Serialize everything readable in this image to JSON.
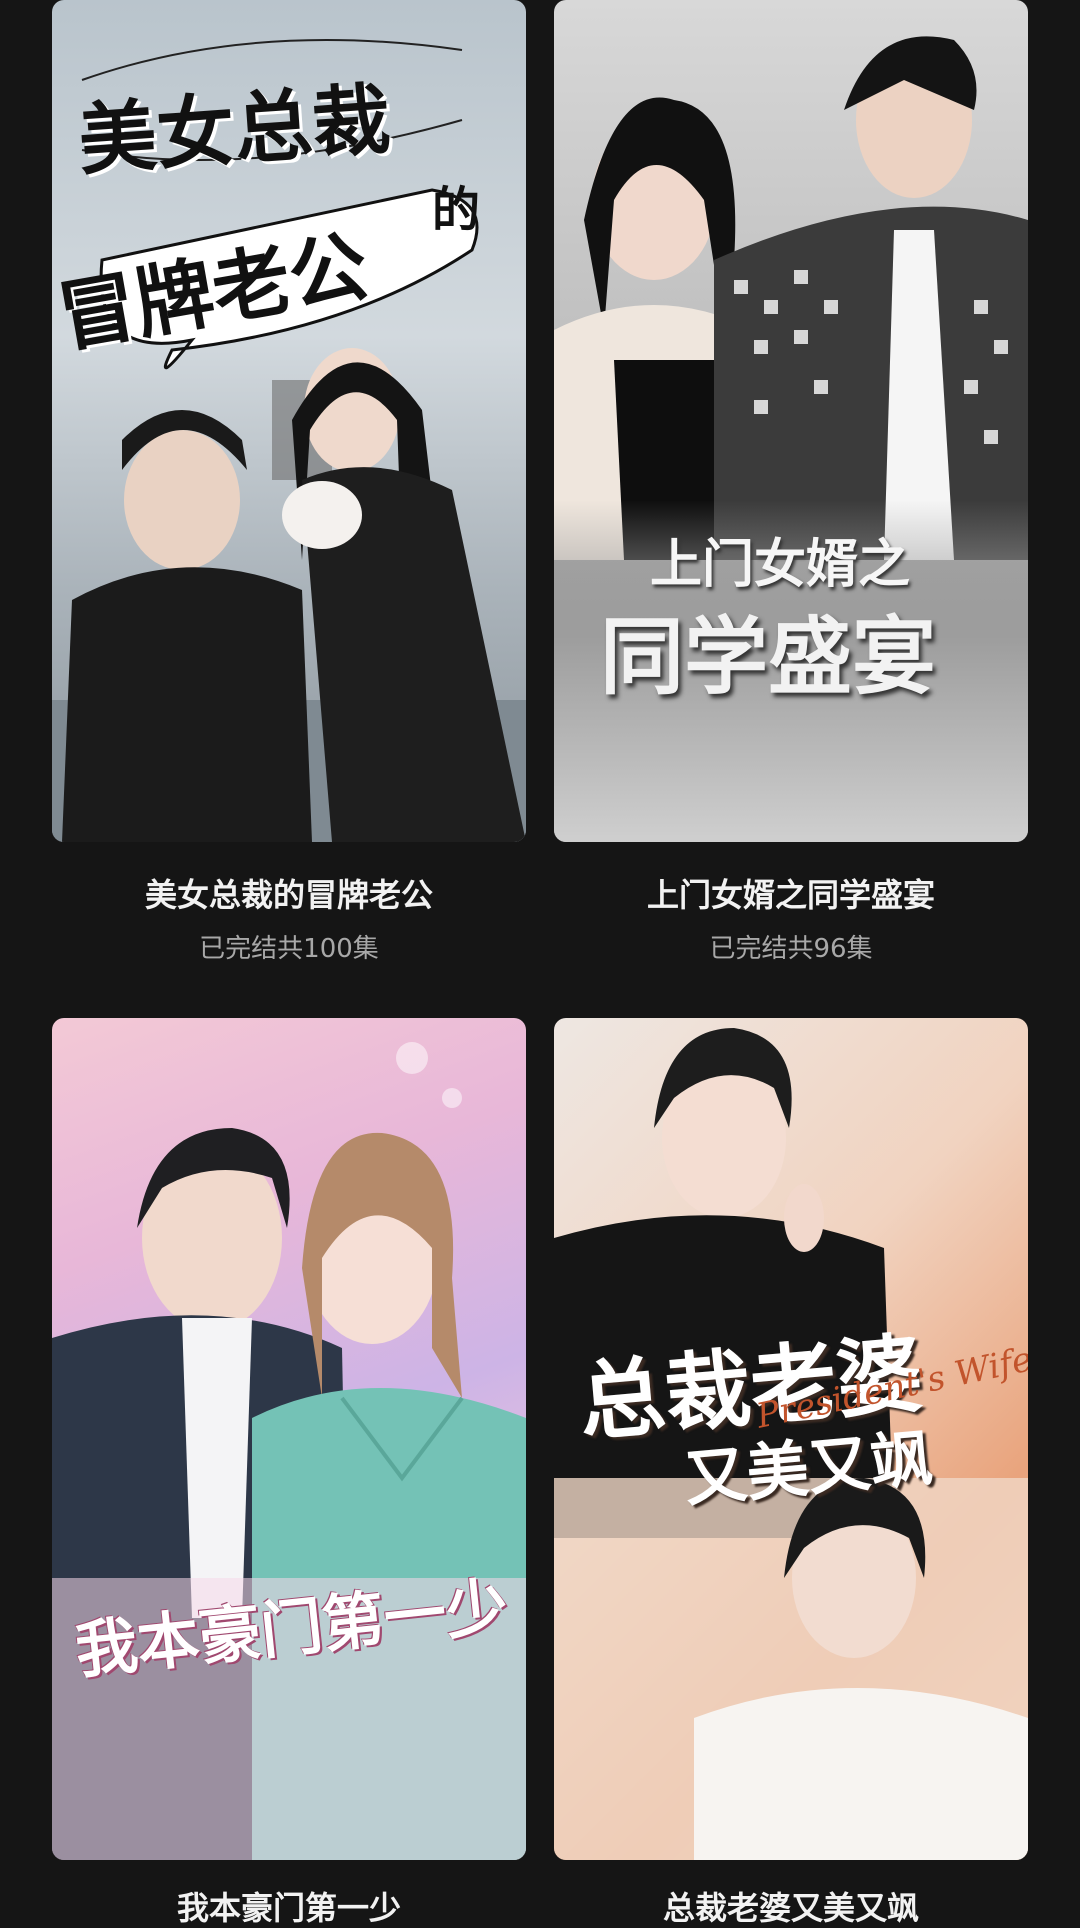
{
  "dramas": [
    {
      "poster_text_line1": "美女总裁",
      "poster_text_de": "的",
      "poster_text_line2": "冒牌老公",
      "title": "美女总裁的冒牌老公",
      "status": "已完结共100集"
    },
    {
      "poster_text_line1": "上门女婿之",
      "poster_text_line2": "同学盛宴",
      "title": "上门女婿之同学盛宴",
      "status": "已完结共96集"
    },
    {
      "poster_text_line1": "我本豪门第一少",
      "title": "我本豪门第一少"
    },
    {
      "poster_text_line1": "总裁老婆",
      "poster_text_line2": "又美又飒",
      "poster_text_script": "President's Wife",
      "title": "总裁老婆又美又飒"
    }
  ]
}
